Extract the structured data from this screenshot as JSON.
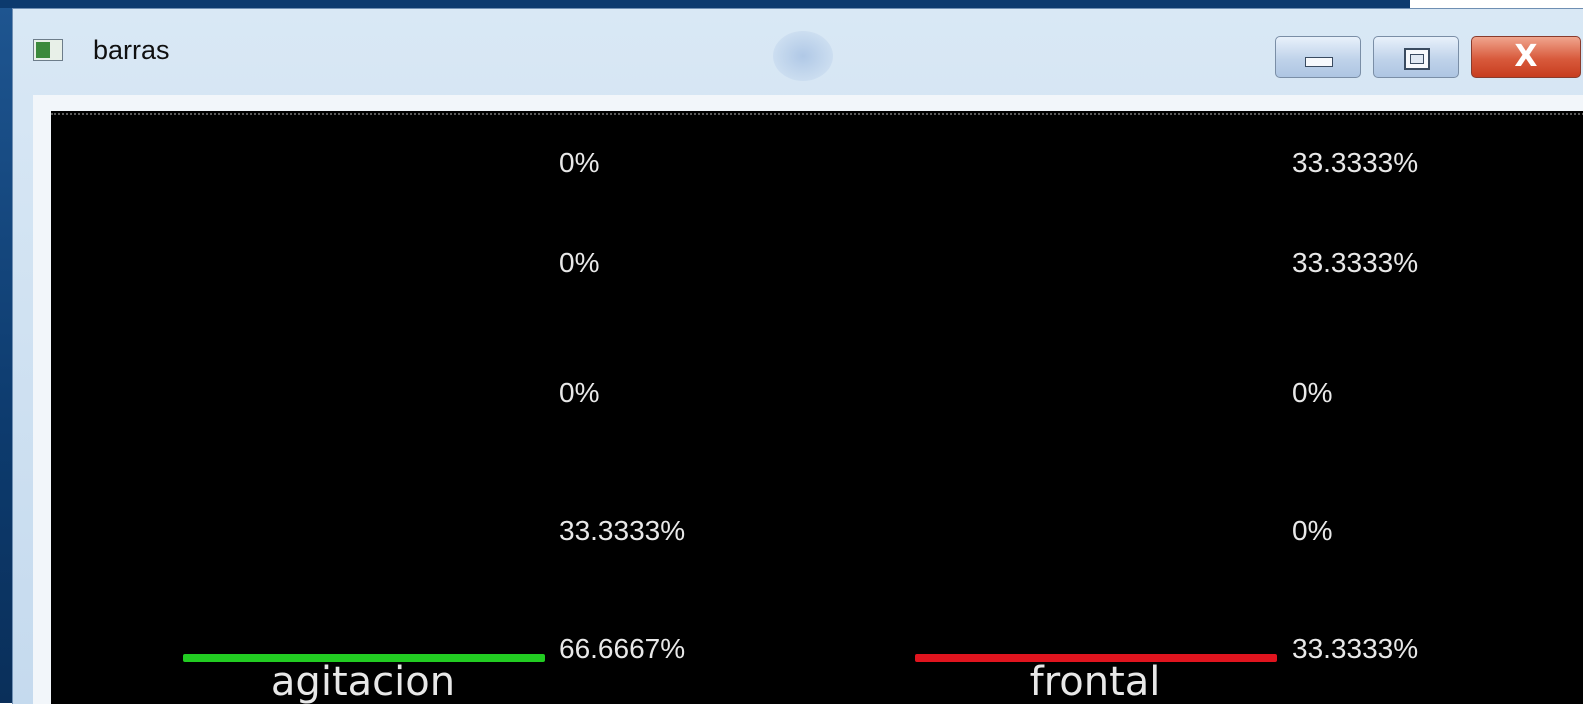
{
  "window": {
    "title": "barras",
    "controls": {
      "minimize": "minimize",
      "maximize": "maximize",
      "close": "X"
    }
  },
  "columns": [
    {
      "label": "agitacion",
      "color": "#22cc22",
      "values": [
        "0%",
        "0%",
        "0%",
        "33.3333%",
        "66.6667%"
      ]
    },
    {
      "label": "frontal",
      "color": "#e0141e",
      "values": [
        "33.3333%",
        "33.3333%",
        "0%",
        "0%",
        "33.3333%"
      ]
    }
  ]
}
